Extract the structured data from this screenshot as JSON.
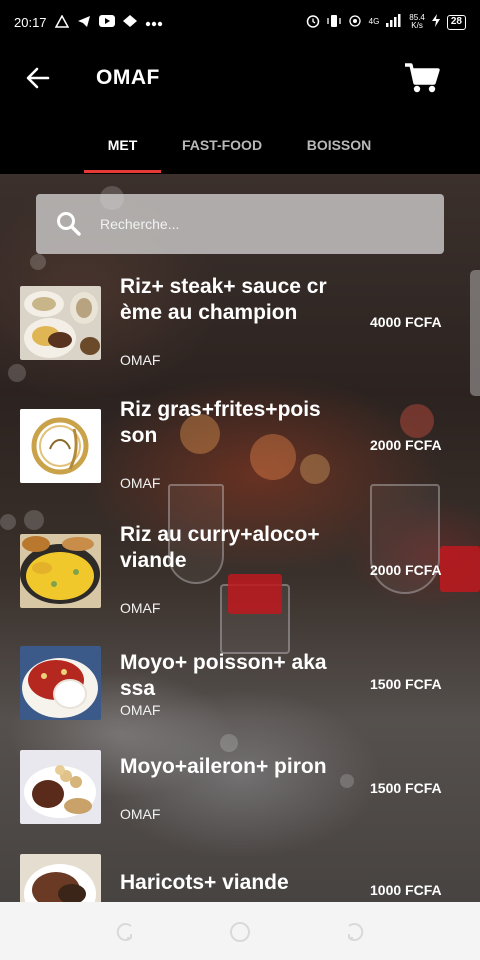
{
  "status_bar": {
    "time": "20:17",
    "left_icons": [
      "warning-icon",
      "telegram-icon",
      "youtube-icon",
      "cloud-icon",
      "more-dots-icon"
    ],
    "net_speed_value": "85.4",
    "net_speed_unit": "K/s",
    "signal_label": "4G",
    "battery": "28"
  },
  "app_bar": {
    "title": "OMAF",
    "back_icon": "arrow-left-icon",
    "cart_icon": "shopping-cart-icon"
  },
  "tabs": [
    {
      "label": "MET",
      "active": true
    },
    {
      "label": "FAST-FOOD",
      "active": false
    },
    {
      "label": "BOISSON",
      "active": false
    }
  ],
  "accent_color": "#e53935",
  "search": {
    "placeholder": "Recherche...",
    "value": ""
  },
  "items": [
    {
      "name": "Riz+ steak+ sauce crème au champion",
      "vendor": "OMAF",
      "price": "4000 FCFA"
    },
    {
      "name": "Riz gras+frites+poisson",
      "vendor": "OMAF",
      "price": "2000 FCFA"
    },
    {
      "name": "Riz  au curry+aloco+viande",
      "vendor": "OMAF",
      "price": "2000 FCFA"
    },
    {
      "name": "Moyo+ poisson+ akassa",
      "vendor": "OMAF",
      "price": "1500 FCFA"
    },
    {
      "name": "Moyo+aileron+ piron",
      "vendor": "OMAF",
      "price": "1500 FCFA"
    },
    {
      "name": "Haricots+ viande",
      "vendor": "",
      "price": "1000 FCFA"
    }
  ],
  "nav_bar": {
    "icons": [
      "back-nav-icon",
      "home-nav-icon",
      "recents-nav-icon"
    ]
  }
}
